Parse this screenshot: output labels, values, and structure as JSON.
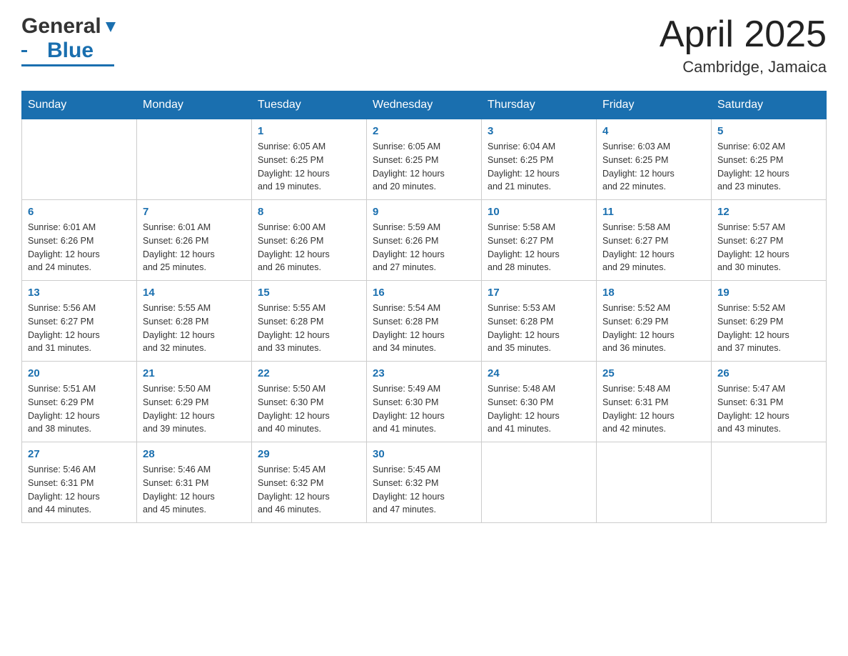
{
  "header": {
    "logo_general": "General",
    "logo_blue": "Blue",
    "month_title": "April 2025",
    "location": "Cambridge, Jamaica"
  },
  "days_of_week": [
    "Sunday",
    "Monday",
    "Tuesday",
    "Wednesday",
    "Thursday",
    "Friday",
    "Saturday"
  ],
  "weeks": [
    [
      {
        "day": "",
        "info": ""
      },
      {
        "day": "",
        "info": ""
      },
      {
        "day": "1",
        "info": "Sunrise: 6:05 AM\nSunset: 6:25 PM\nDaylight: 12 hours\nand 19 minutes."
      },
      {
        "day": "2",
        "info": "Sunrise: 6:05 AM\nSunset: 6:25 PM\nDaylight: 12 hours\nand 20 minutes."
      },
      {
        "day": "3",
        "info": "Sunrise: 6:04 AM\nSunset: 6:25 PM\nDaylight: 12 hours\nand 21 minutes."
      },
      {
        "day": "4",
        "info": "Sunrise: 6:03 AM\nSunset: 6:25 PM\nDaylight: 12 hours\nand 22 minutes."
      },
      {
        "day": "5",
        "info": "Sunrise: 6:02 AM\nSunset: 6:25 PM\nDaylight: 12 hours\nand 23 minutes."
      }
    ],
    [
      {
        "day": "6",
        "info": "Sunrise: 6:01 AM\nSunset: 6:26 PM\nDaylight: 12 hours\nand 24 minutes."
      },
      {
        "day": "7",
        "info": "Sunrise: 6:01 AM\nSunset: 6:26 PM\nDaylight: 12 hours\nand 25 minutes."
      },
      {
        "day": "8",
        "info": "Sunrise: 6:00 AM\nSunset: 6:26 PM\nDaylight: 12 hours\nand 26 minutes."
      },
      {
        "day": "9",
        "info": "Sunrise: 5:59 AM\nSunset: 6:26 PM\nDaylight: 12 hours\nand 27 minutes."
      },
      {
        "day": "10",
        "info": "Sunrise: 5:58 AM\nSunset: 6:27 PM\nDaylight: 12 hours\nand 28 minutes."
      },
      {
        "day": "11",
        "info": "Sunrise: 5:58 AM\nSunset: 6:27 PM\nDaylight: 12 hours\nand 29 minutes."
      },
      {
        "day": "12",
        "info": "Sunrise: 5:57 AM\nSunset: 6:27 PM\nDaylight: 12 hours\nand 30 minutes."
      }
    ],
    [
      {
        "day": "13",
        "info": "Sunrise: 5:56 AM\nSunset: 6:27 PM\nDaylight: 12 hours\nand 31 minutes."
      },
      {
        "day": "14",
        "info": "Sunrise: 5:55 AM\nSunset: 6:28 PM\nDaylight: 12 hours\nand 32 minutes."
      },
      {
        "day": "15",
        "info": "Sunrise: 5:55 AM\nSunset: 6:28 PM\nDaylight: 12 hours\nand 33 minutes."
      },
      {
        "day": "16",
        "info": "Sunrise: 5:54 AM\nSunset: 6:28 PM\nDaylight: 12 hours\nand 34 minutes."
      },
      {
        "day": "17",
        "info": "Sunrise: 5:53 AM\nSunset: 6:28 PM\nDaylight: 12 hours\nand 35 minutes."
      },
      {
        "day": "18",
        "info": "Sunrise: 5:52 AM\nSunset: 6:29 PM\nDaylight: 12 hours\nand 36 minutes."
      },
      {
        "day": "19",
        "info": "Sunrise: 5:52 AM\nSunset: 6:29 PM\nDaylight: 12 hours\nand 37 minutes."
      }
    ],
    [
      {
        "day": "20",
        "info": "Sunrise: 5:51 AM\nSunset: 6:29 PM\nDaylight: 12 hours\nand 38 minutes."
      },
      {
        "day": "21",
        "info": "Sunrise: 5:50 AM\nSunset: 6:29 PM\nDaylight: 12 hours\nand 39 minutes."
      },
      {
        "day": "22",
        "info": "Sunrise: 5:50 AM\nSunset: 6:30 PM\nDaylight: 12 hours\nand 40 minutes."
      },
      {
        "day": "23",
        "info": "Sunrise: 5:49 AM\nSunset: 6:30 PM\nDaylight: 12 hours\nand 41 minutes."
      },
      {
        "day": "24",
        "info": "Sunrise: 5:48 AM\nSunset: 6:30 PM\nDaylight: 12 hours\nand 41 minutes."
      },
      {
        "day": "25",
        "info": "Sunrise: 5:48 AM\nSunset: 6:31 PM\nDaylight: 12 hours\nand 42 minutes."
      },
      {
        "day": "26",
        "info": "Sunrise: 5:47 AM\nSunset: 6:31 PM\nDaylight: 12 hours\nand 43 minutes."
      }
    ],
    [
      {
        "day": "27",
        "info": "Sunrise: 5:46 AM\nSunset: 6:31 PM\nDaylight: 12 hours\nand 44 minutes."
      },
      {
        "day": "28",
        "info": "Sunrise: 5:46 AM\nSunset: 6:31 PM\nDaylight: 12 hours\nand 45 minutes."
      },
      {
        "day": "29",
        "info": "Sunrise: 5:45 AM\nSunset: 6:32 PM\nDaylight: 12 hours\nand 46 minutes."
      },
      {
        "day": "30",
        "info": "Sunrise: 5:45 AM\nSunset: 6:32 PM\nDaylight: 12 hours\nand 47 minutes."
      },
      {
        "day": "",
        "info": ""
      },
      {
        "day": "",
        "info": ""
      },
      {
        "day": "",
        "info": ""
      }
    ]
  ]
}
